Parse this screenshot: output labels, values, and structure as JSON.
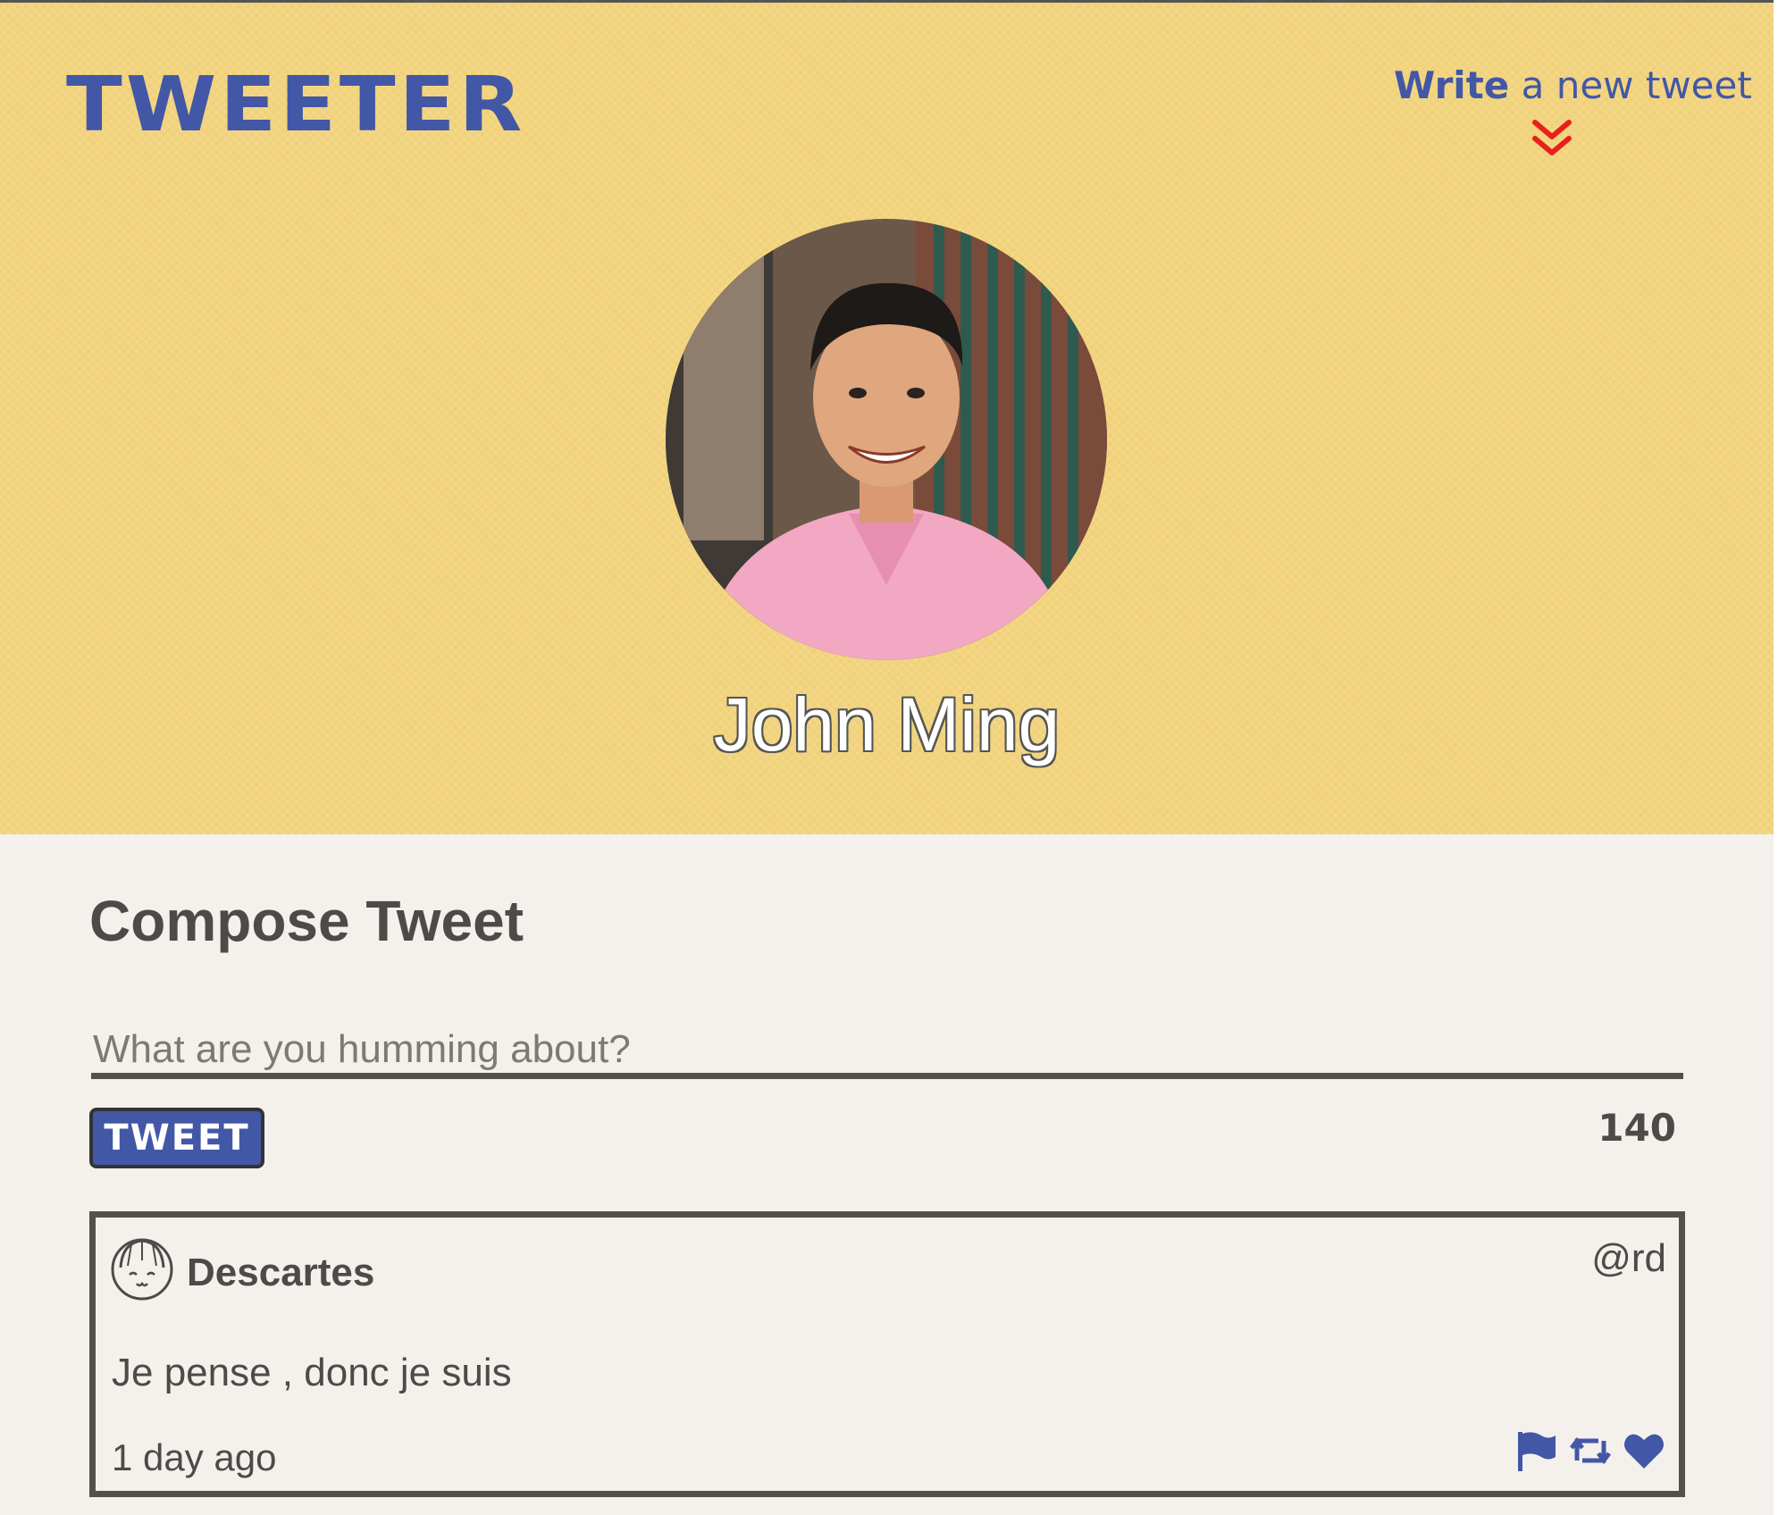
{
  "header": {
    "logo": "TWEETER",
    "nav_bold": "Write",
    "nav_rest": " a new tweet",
    "user_name": "John Ming"
  },
  "compose": {
    "title": "Compose Tweet",
    "placeholder": "What are you humming about?",
    "button_label": "TWEET",
    "counter": "140"
  },
  "tweet": {
    "author": "Descartes",
    "handle": "@rd",
    "text": "Je pense , donc je suis",
    "time": "1 day ago"
  },
  "colors": {
    "header_bg": "#f2d47f",
    "brand_blue": "#4257a6",
    "accent_red": "#e8201a",
    "text_dark": "#4d4b47",
    "page_bg": "#f4f1ec"
  },
  "icons": {
    "nav": "double-chevron-down-icon",
    "tweet_avatar": "cartoon-face-icon",
    "actions": [
      "flag-icon",
      "retweet-icon",
      "heart-icon"
    ]
  }
}
